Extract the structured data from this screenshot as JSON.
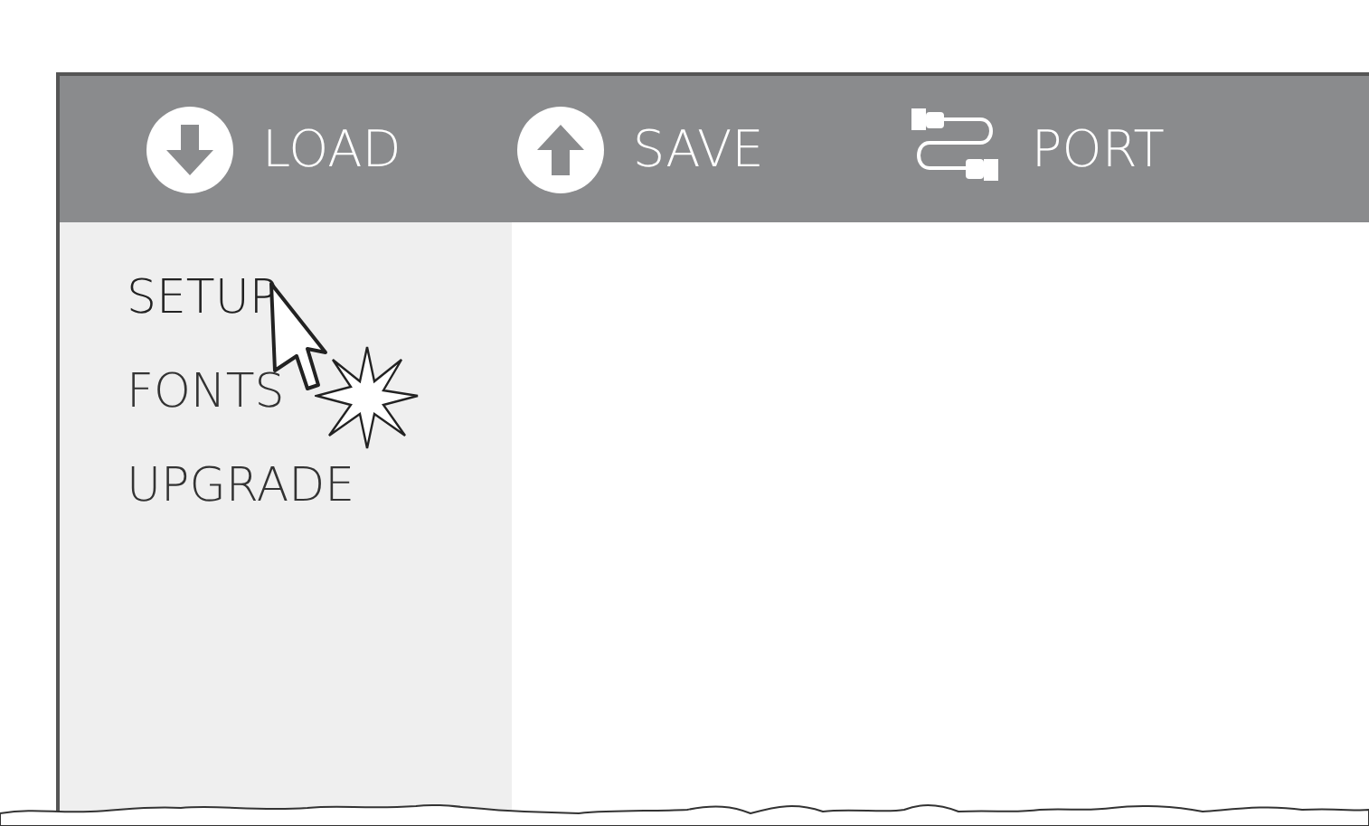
{
  "toolbar": [
    {
      "kind": "load",
      "label": "LOAD"
    },
    {
      "kind": "save",
      "label": "SAVE"
    },
    {
      "kind": "port",
      "label": "PORT"
    }
  ],
  "menu": [
    {
      "label": "SETUP",
      "selected": true
    },
    {
      "label": "FONTS",
      "selected": false
    },
    {
      "label": "UPGRADE",
      "selected": false
    }
  ]
}
